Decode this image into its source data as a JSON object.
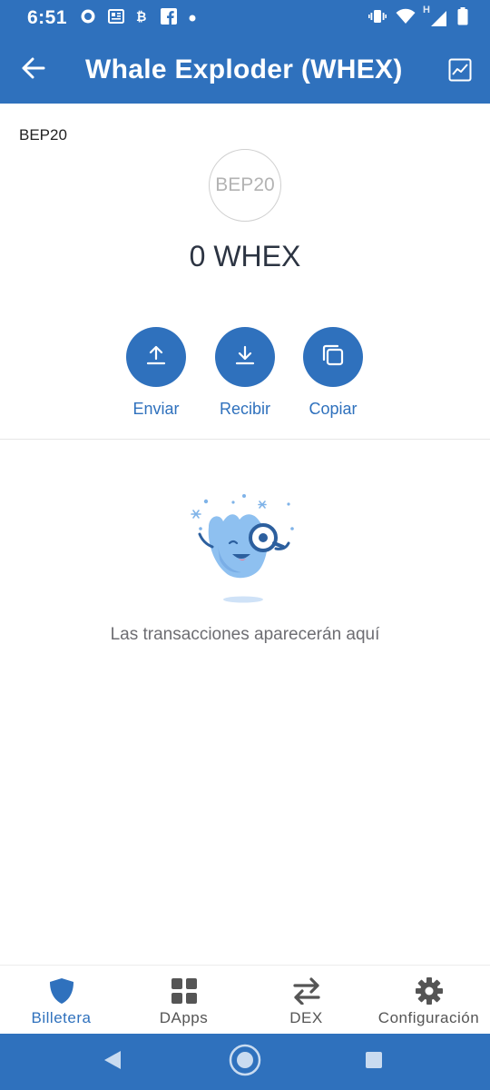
{
  "status_bar": {
    "time": "6:51",
    "left_icons": [
      "signal-app-icon",
      "news-icon",
      "crypto-icon",
      "facebook-icon",
      "dot-icon"
    ],
    "right_icons": [
      "vibrate-icon",
      "wifi-icon",
      "h-signal-icon",
      "battery-icon"
    ],
    "network_label": "H"
  },
  "app_bar": {
    "title": "Whale Exploder (WHEX)",
    "back_icon": "arrow-left-icon",
    "chart_icon": "chart-icon"
  },
  "token": {
    "type_label": "BEP20",
    "logo_text": "BEP20",
    "balance": "0 WHEX"
  },
  "actions": [
    {
      "label": "Enviar",
      "icon": "upload-icon"
    },
    {
      "label": "Recibir",
      "icon": "download-icon"
    },
    {
      "label": "Copiar",
      "icon": "copy-icon"
    }
  ],
  "empty_state": {
    "text": "Las transacciones aparecerán aquí",
    "illustration": "whale-magnifier-icon"
  },
  "bottom_nav": {
    "items": [
      {
        "label": "Billetera",
        "icon": "shield-icon",
        "active": true
      },
      {
        "label": "DApps",
        "icon": "grid-icon",
        "active": false
      },
      {
        "label": "DEX",
        "icon": "swap-icon",
        "active": false
      },
      {
        "label": "Configuración",
        "icon": "gear-icon",
        "active": false
      }
    ]
  },
  "colors": {
    "primary": "#2f71bd",
    "balance_text": "#2c3442",
    "muted_text": "#6d6d72"
  }
}
